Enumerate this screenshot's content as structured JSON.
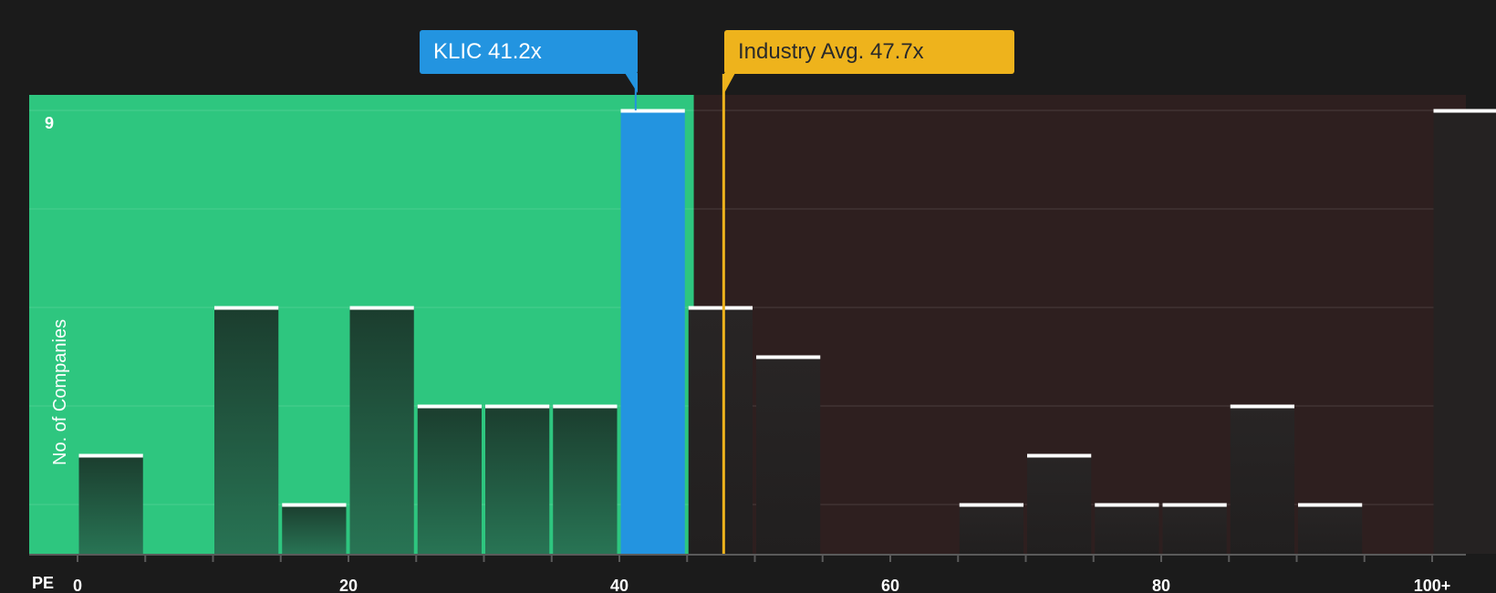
{
  "chart_data": {
    "type": "bar",
    "xlabel": "PE",
    "ylabel": "No. of Companies",
    "ylim": [
      0,
      9
    ],
    "y_tick_label": "9",
    "grid": true,
    "x_ticks": [
      "0",
      "20",
      "40",
      "60",
      "80",
      "100+"
    ],
    "bins": [
      {
        "start": 0,
        "end": 5,
        "count": 2
      },
      {
        "start": 5,
        "end": 10,
        "count": 0
      },
      {
        "start": 10,
        "end": 15,
        "count": 5
      },
      {
        "start": 15,
        "end": 20,
        "count": 1
      },
      {
        "start": 20,
        "end": 25,
        "count": 5
      },
      {
        "start": 25,
        "end": 30,
        "count": 3
      },
      {
        "start": 30,
        "end": 35,
        "count": 3
      },
      {
        "start": 35,
        "end": 40,
        "count": 3
      },
      {
        "start": 40,
        "end": 45,
        "count": 9,
        "highlight": true
      },
      {
        "start": 45,
        "end": 50,
        "count": 5
      },
      {
        "start": 50,
        "end": 55,
        "count": 4
      },
      {
        "start": 55,
        "end": 60,
        "count": 0
      },
      {
        "start": 60,
        "end": 65,
        "count": 0
      },
      {
        "start": 65,
        "end": 70,
        "count": 1
      },
      {
        "start": 70,
        "end": 75,
        "count": 2
      },
      {
        "start": 75,
        "end": 80,
        "count": 1
      },
      {
        "start": 80,
        "end": 85,
        "count": 1
      },
      {
        "start": 85,
        "end": 90,
        "count": 3
      },
      {
        "start": 90,
        "end": 95,
        "count": 1
      },
      {
        "start": 95,
        "end": 100,
        "count": 0
      },
      {
        "start": 100,
        "end": 105,
        "count": 9,
        "overflow": true
      }
    ],
    "company": {
      "ticker": "KLIC",
      "pe": 41.2,
      "label": "KLIC 41.2x"
    },
    "industry": {
      "pe": 47.7,
      "label": "Industry Avg. 47.7x"
    },
    "colors": {
      "undervalued_zone": "#2ec67f",
      "overvalued_zone": "#2e1f1f",
      "company": "#2394e0",
      "industry": "#eeb31c",
      "bar_top": "#ffffff"
    }
  }
}
